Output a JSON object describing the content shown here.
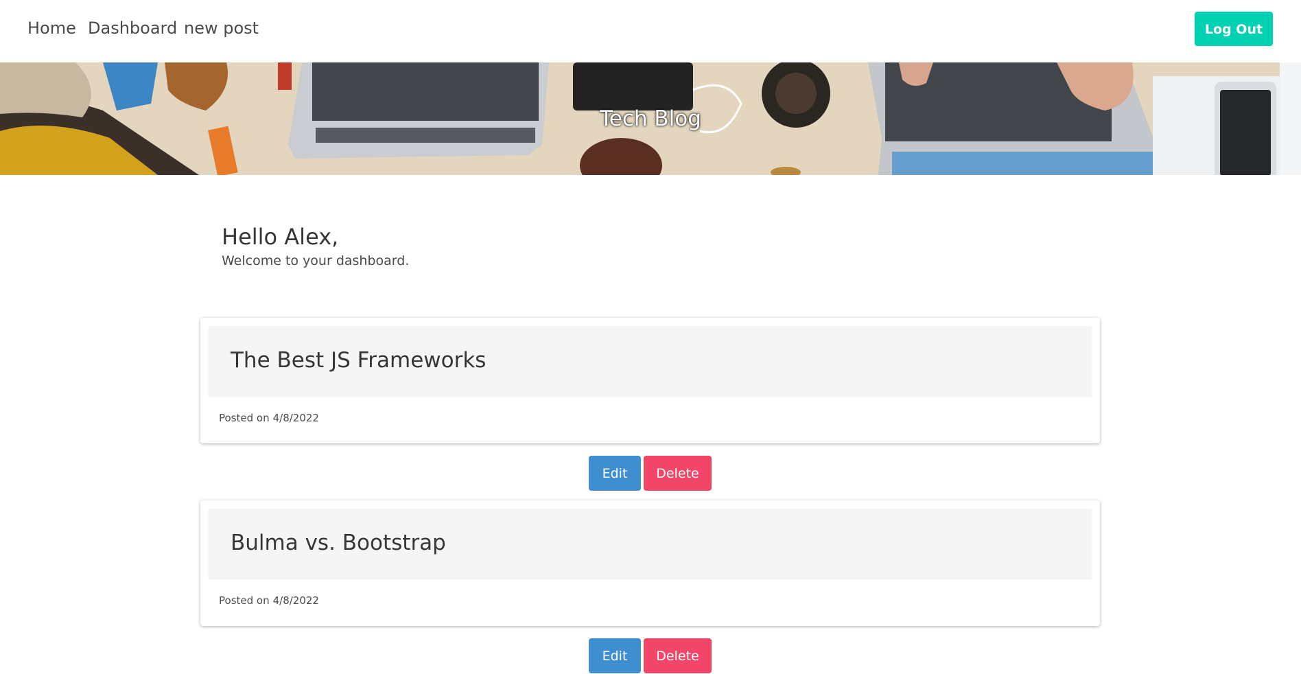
{
  "nav": {
    "links": [
      {
        "label": "Home"
      },
      {
        "label": "Dashboard"
      },
      {
        "label": "new post"
      }
    ],
    "logout_label": "Log Out"
  },
  "hero": {
    "title": "Tech Blog"
  },
  "dashboard": {
    "greeting": "Hello Alex,",
    "welcome": "Welcome to your dashboard."
  },
  "posts": [
    {
      "title": "The Best JS Frameworks",
      "date_prefix": "Posted on",
      "date": "4/8/2022",
      "edit_label": "Edit",
      "delete_label": "Delete"
    },
    {
      "title": "Bulma vs. Bootstrap",
      "date_prefix": "Posted on",
      "date": "4/8/2022",
      "edit_label": "Edit",
      "delete_label": "Delete"
    }
  ],
  "colors": {
    "logout": "#00d1b2",
    "edit": "#3e8ed0",
    "delete": "#f14668"
  }
}
